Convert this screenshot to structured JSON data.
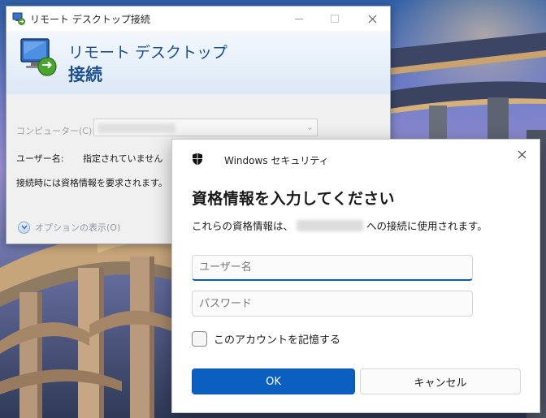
{
  "desktop": {
    "wallpaper": "bridge-night-wallpaper"
  },
  "rdp_window": {
    "title": "リモート デスクトップ接続",
    "app_icon": "remote-desktop-icon",
    "banner": {
      "line1": "リモート デスクトップ",
      "line2": "接続",
      "logo": "monitor-connection-icon"
    },
    "computer_label": "コンピューター(C):",
    "computer_value": "",
    "username_label": "ユーザー名:",
    "username_value": "指定されていません",
    "credentials_note": "接続時には資格情報を要求されます。",
    "options_toggle": "オプションの表示(O)",
    "buttons": {
      "minimize": "minimize-icon",
      "maximize": "maximize-icon",
      "close": "close-icon"
    }
  },
  "security_dialog": {
    "app_title": "Windows セキュリティ",
    "heading": "資格情報を入力してください",
    "description_prefix": "これらの資格情報は、",
    "description_suffix": "への接続に使用されます。",
    "username_placeholder": "ユーザー名",
    "password_placeholder": "パスワード",
    "remember_label": "このアカウントを記憶する",
    "remember_checked": false,
    "ok_label": "OK",
    "cancel_label": "キャンセル",
    "accent_color": "#0a5fc0"
  }
}
